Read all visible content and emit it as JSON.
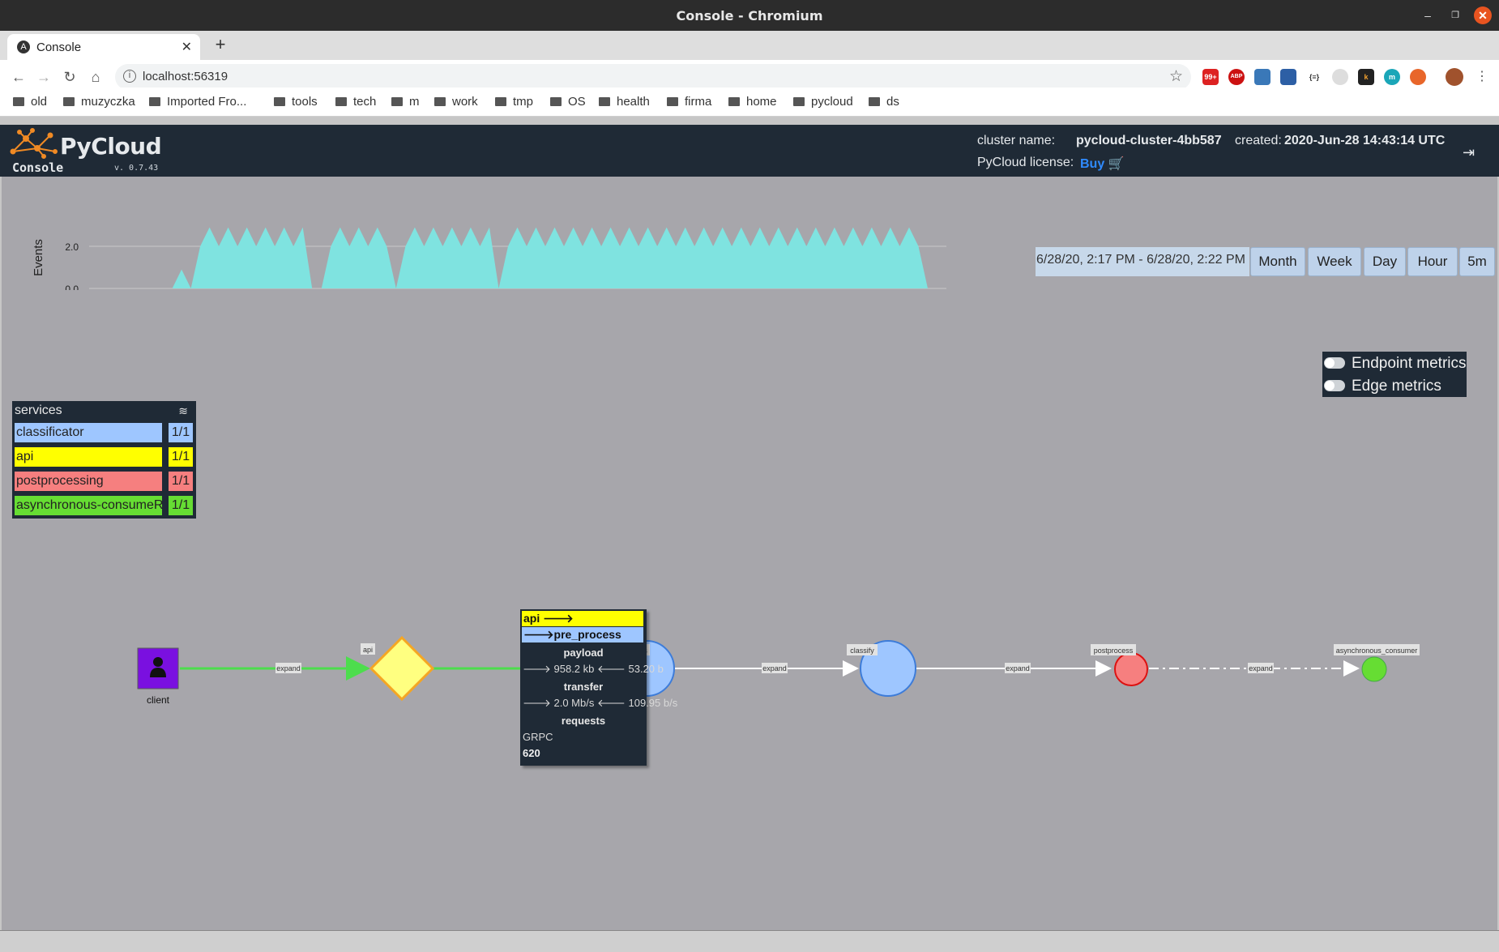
{
  "window": {
    "title": "Console - Chromium"
  },
  "tab": {
    "title": "Console"
  },
  "address": {
    "url": "localhost:56319"
  },
  "extensions": [
    "99+",
    "ABP",
    "",
    "",
    "{≡}",
    "",
    "k",
    "m",
    "",
    ""
  ],
  "bookmarks": [
    "old",
    "muzyczka",
    "Imported Fro...",
    "tools",
    "tech",
    "m",
    "work",
    "tmp",
    "OS",
    "health",
    "firma",
    "home",
    "pycloud",
    "ds"
  ],
  "app": {
    "brand": "PyCloud",
    "console_label": "Console",
    "version": "v. 0.7.43",
    "cluster_label": "cluster name:",
    "cluster_name": "pycloud-cluster-4bb587",
    "created_label": "created:",
    "created_value": "2020-Jun-28 14:43:14 UTC",
    "license_label": "PyCloud license:",
    "license_buy": "Buy"
  },
  "timeline": {
    "range_text": "6/28/20, 2:17 PM - 6/28/20, 2:22 PM",
    "buttons": [
      "Month",
      "Week",
      "Day",
      "Hour",
      "5m"
    ],
    "chart_data": {
      "type": "area",
      "ylabel": "Events",
      "y_ticks": [
        "2.0",
        "0.0"
      ],
      "ylim": [
        0,
        3
      ],
      "color": "#7fe3e0",
      "series": [
        {
          "values": [
            0,
            0,
            0,
            0,
            0,
            0,
            0,
            0,
            0.9,
            0,
            2.0,
            2.9,
            2.0,
            2.9,
            2.0,
            2.9,
            2.0,
            2.9,
            2.0,
            2.9,
            2.0,
            2.9,
            0,
            0,
            2.0,
            2.9,
            2.0,
            2.9,
            2.0,
            2.9,
            2.0,
            0,
            2.0,
            2.9,
            2.0,
            2.9,
            2.0,
            2.9,
            2.0,
            2.9,
            2.0,
            2.9,
            0,
            2.0,
            2.9,
            2.0,
            2.9,
            2.0,
            2.9,
            2.0,
            2.9,
            2.0,
            2.9,
            2.0,
            2.9,
            2.0,
            2.9,
            2.0,
            2.9,
            2.0,
            2.9,
            2.0,
            2.9,
            2.0,
            2.9,
            2.0,
            2.9,
            2.0,
            2.9,
            2.0,
            2.9,
            2.0,
            2.9,
            2.0,
            2.9,
            2.0,
            2.9,
            2.0,
            2.9,
            2.0,
            2.9,
            2.0,
            2.9,
            2.0,
            2.9,
            2.0,
            2.9,
            2.0,
            0,
            0,
            0
          ]
        }
      ]
    }
  },
  "metrics": {
    "endpoint": "Endpoint metrics",
    "edge": "Edge metrics"
  },
  "services": {
    "title": "services",
    "items": [
      {
        "name": "classificator",
        "count": "1/1",
        "color": "#9ec6ff"
      },
      {
        "name": "api",
        "count": "1/1",
        "color": "#ffff00"
      },
      {
        "name": "postprocessing",
        "count": "1/1",
        "color": "#f67f7f"
      },
      {
        "name": "asynchronous-consumeR",
        "count": "1/1",
        "color": "#66dd33"
      }
    ]
  },
  "graph": {
    "client_label": "client",
    "node_labels": [
      "api",
      "pre_process",
      "classify",
      "postprocess",
      "asynchronous_consumer"
    ],
    "edge_label": "expand"
  },
  "tooltip": {
    "service": "api",
    "endpoint": "pre_process",
    "payload_title": "payload",
    "payload_out": "958.2 kb",
    "payload_in": "53.20 b",
    "transfer_title": "transfer",
    "transfer_out": "2.0 Mb/s",
    "transfer_in": "109.95 b/s",
    "requests_title": "requests",
    "protocol": "GRPC",
    "count": "620"
  }
}
